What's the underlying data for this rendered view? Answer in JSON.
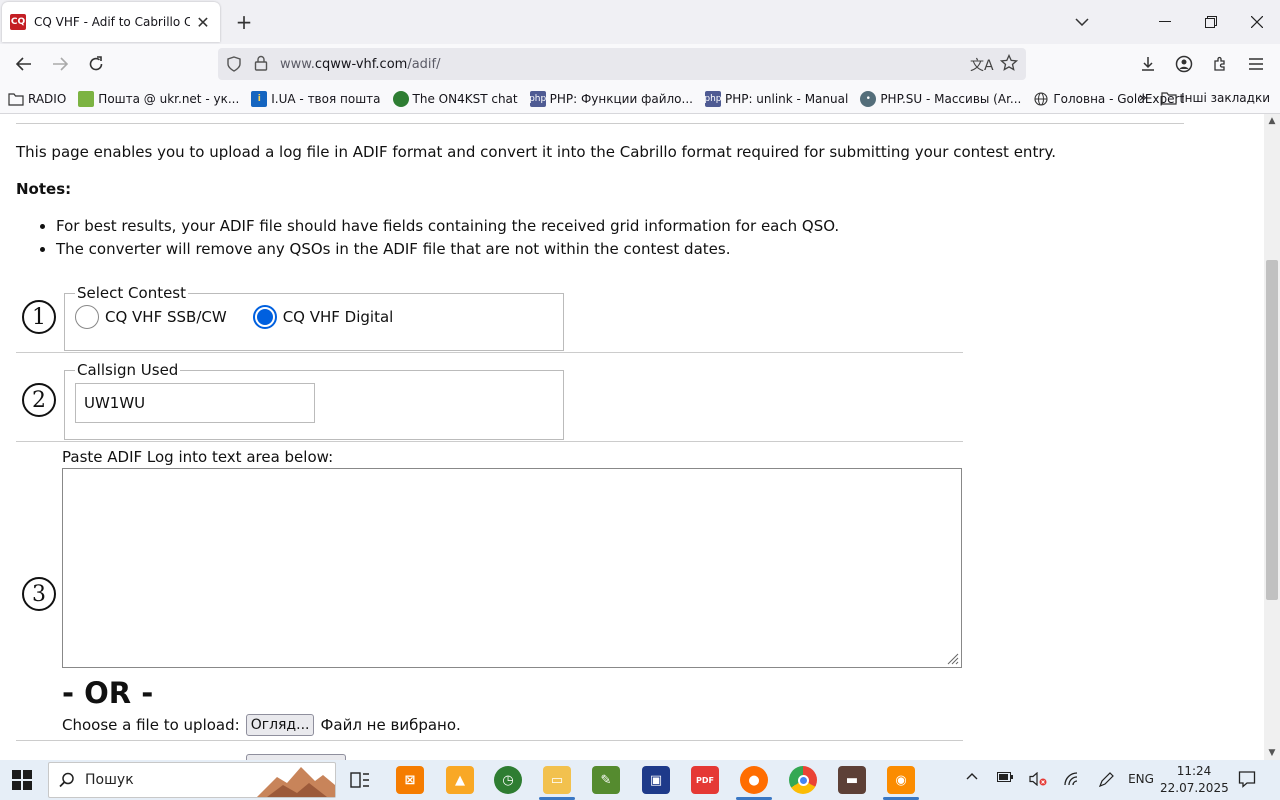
{
  "browser": {
    "tab_title": "CQ VHF - Adif to Cabrillo Converter",
    "url_prefix": "www.",
    "url_host": "cqww-vhf.com",
    "url_path": "/adif/"
  },
  "bookmarks": [
    {
      "label": "RADIO",
      "icon": "folder-icon"
    },
    {
      "label": "Пошта @ ukr.net - ук...",
      "icon": "mail-icon"
    },
    {
      "label": "I.UA - твоя пошта",
      "icon": "info-icon"
    },
    {
      "label": "The ON4KST chat",
      "icon": "globe-icon"
    },
    {
      "label": "PHP: Функции файло...",
      "icon": "php-icon"
    },
    {
      "label": "PHP: unlink - Manual",
      "icon": "php-icon"
    },
    {
      "label": "PHP.SU - Массивы (Ar...",
      "icon": "php-icon"
    },
    {
      "label": "Головна - GoldExpert",
      "icon": "globe-icon"
    }
  ],
  "other_bookmarks": "Інші закладки",
  "page": {
    "intro": "This page enables you to upload a log file in ADIF format and convert it into the Cabrillo format required for submitting your contest entry.",
    "notes_heading": "Notes:",
    "notes": [
      "For best results, your ADIF file should have fields containing the received grid information for each QSO.",
      "The converter will remove any QSOs in the ADIF file that are not within the contest dates."
    ],
    "step1": {
      "number": "1",
      "legend": "Select Contest",
      "options": [
        {
          "label": "CQ VHF SSB/CW",
          "checked": false
        },
        {
          "label": "CQ VHF Digital",
          "checked": true
        }
      ]
    },
    "step2": {
      "number": "2",
      "legend": "Callsign Used",
      "value": "UW1WU"
    },
    "step3": {
      "number": "3",
      "paste_label": "Paste ADIF Log into text area below:",
      "textarea_value": "",
      "or_text": "- OR -",
      "upload_label": "Choose a file to upload:",
      "browse_label": "Огляд...",
      "no_file_text": "Файл не вибрано."
    }
  },
  "taskbar": {
    "search_placeholder": "Пошук",
    "language": "ENG",
    "time": "11:24",
    "date": "22.07.2025"
  }
}
